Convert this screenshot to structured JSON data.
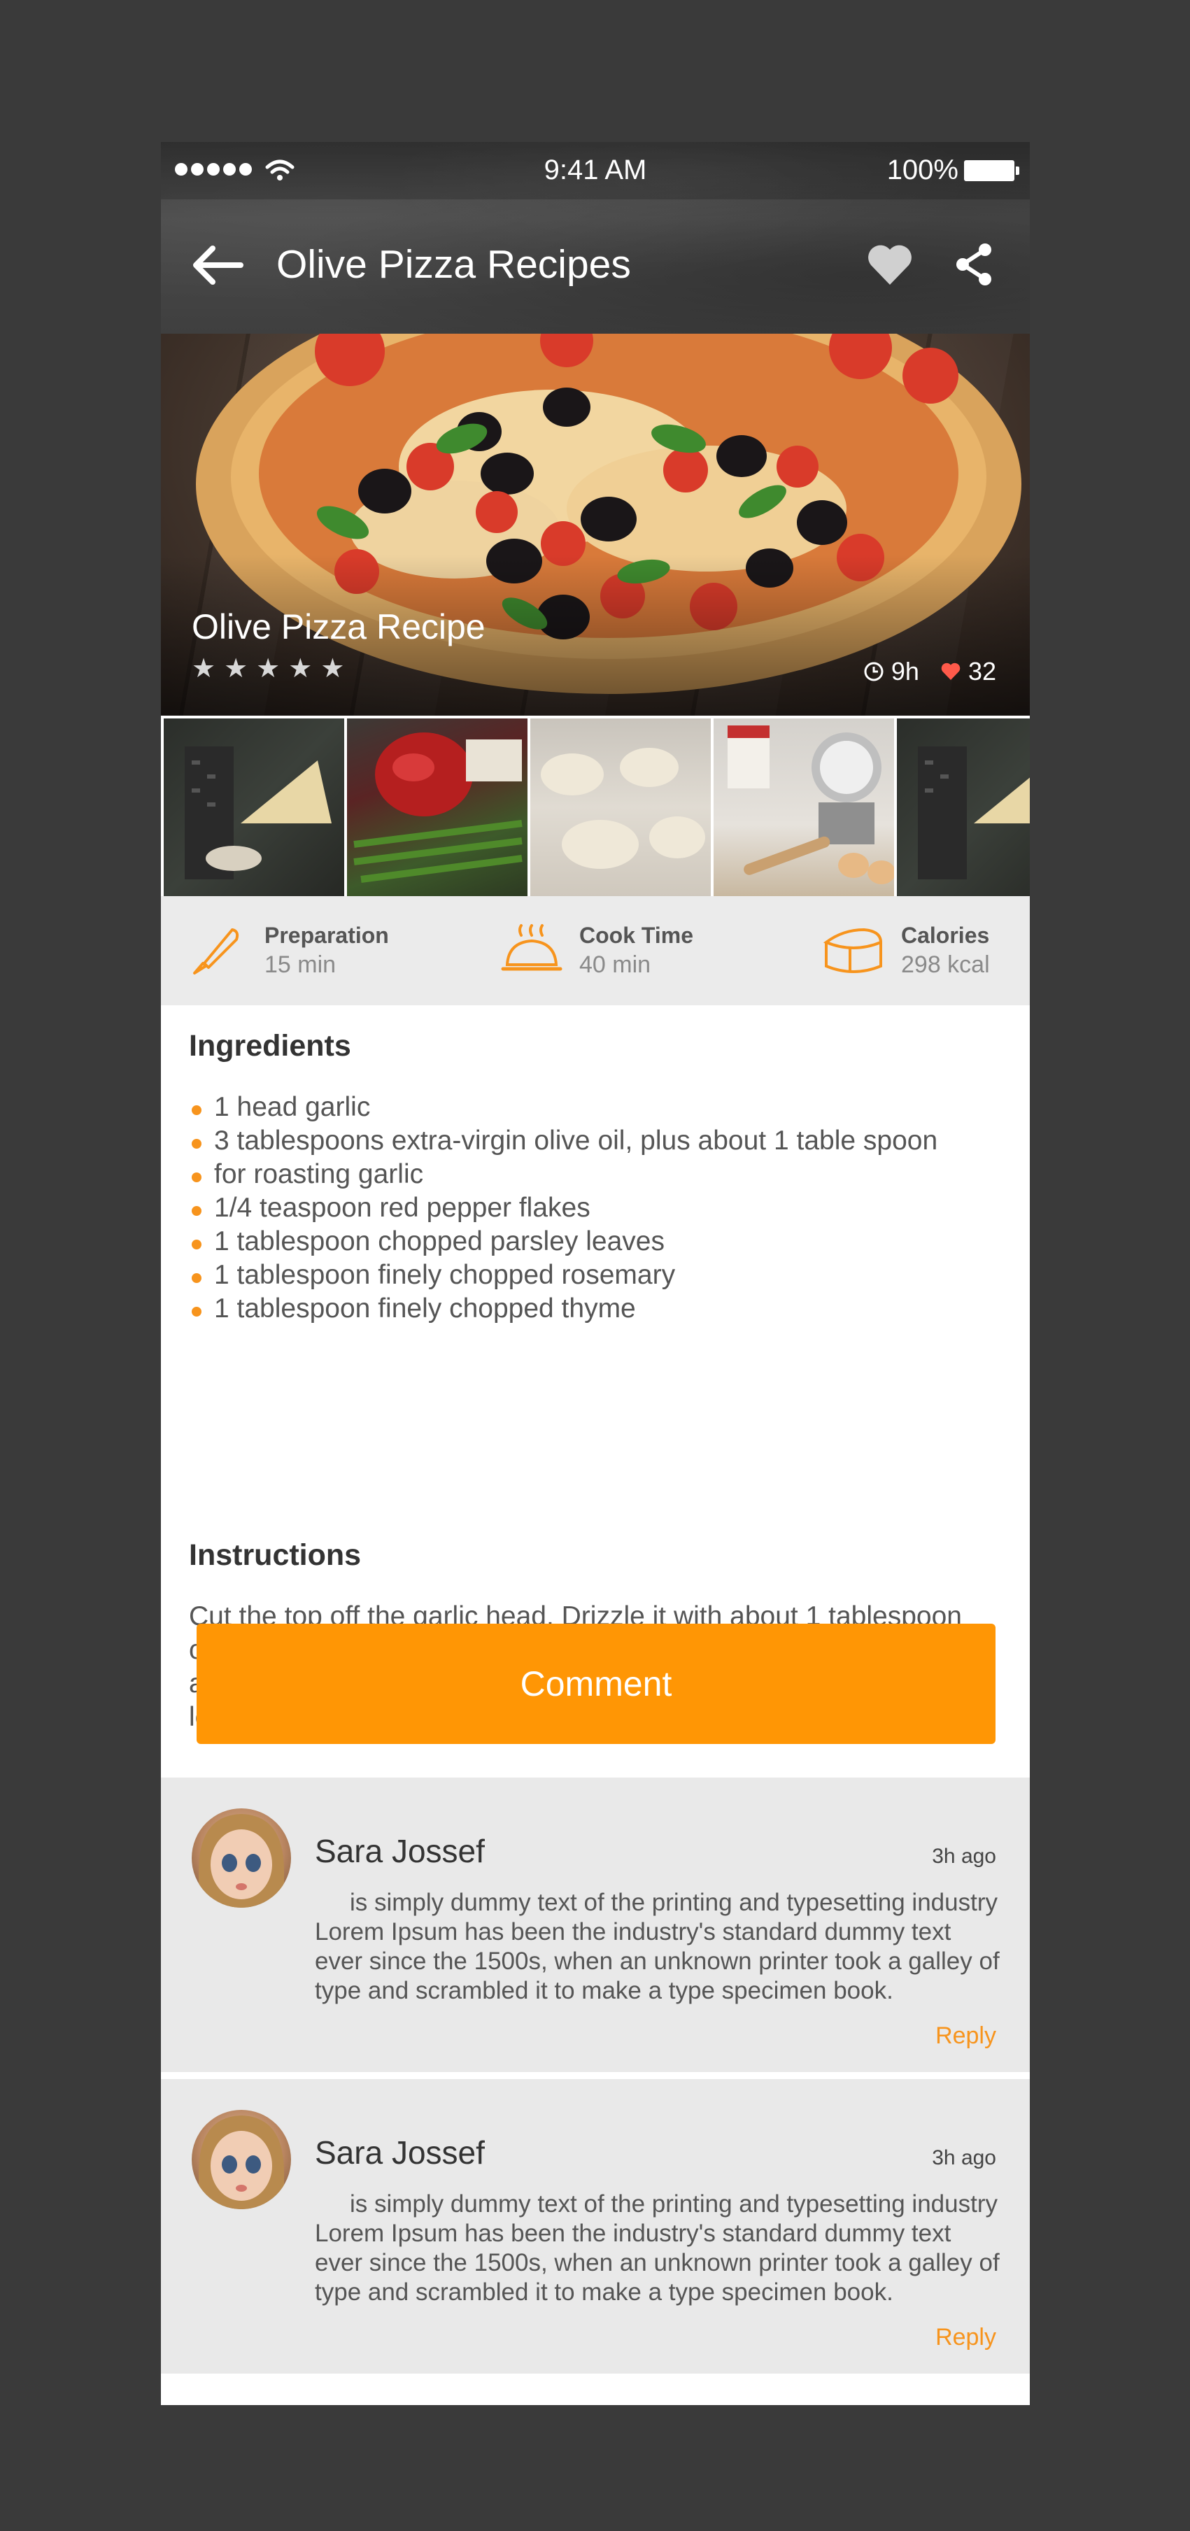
{
  "status_bar": {
    "time": "9:41 AM",
    "battery": "100%"
  },
  "nav": {
    "title": "Olive Pizza Recipes",
    "back_icon": "arrow-left-icon",
    "favorite_icon": "heart-icon",
    "share_icon": "share-icon"
  },
  "hero": {
    "title": "Olive Pizza Recipe",
    "rating_stars": 5,
    "time": "9h",
    "likes": "32"
  },
  "thumbnails": [
    {
      "subject": "grater-and-cheese"
    },
    {
      "subject": "vegetables"
    },
    {
      "subject": "dough-balls"
    },
    {
      "subject": "kitchen-scale"
    },
    {
      "subject": "grater-and-cheese"
    }
  ],
  "stats": [
    {
      "label": "Preparation",
      "value": "15 min",
      "icon": "knife-icon"
    },
    {
      "label": "Cook Time",
      "value": "40 min",
      "icon": "serving-dish-icon"
    },
    {
      "label": "Calories",
      "value": "298 kcal",
      "icon": "cheese-icon"
    }
  ],
  "ingredients": {
    "heading": "Ingredients",
    "items": [
      "1 head garlic",
      "3 tablespoons extra-virgin olive oil, plus about 1 table spoon",
      "for roasting garlic",
      "1/4 teaspoon red pepper flakes",
      "1 tablespoon chopped parsley leaves",
      "1 tablespoon finely chopped rosemary",
      "1 tablespoon finely chopped thyme"
    ]
  },
  "instructions": {
    "heading": "Instructions",
    "text": "Cut the top off the garlic head. Drizzle it with about 1 tablespoon olive oil, season with salt and pepper, to taste, and wrap in aluminum foil. Roast in the oven for 30 minutes, then remove and let cool."
  },
  "comment_button": "Comment",
  "comments": [
    {
      "name": "Sara Jossef",
      "ago": "3h ago",
      "text": "is simply dummy text of the printing and typesetting industry Lorem Ipsum has been the industry's standard dummy text ever since the 1500s, when an unknown printer took a galley of type and scrambled it to make a type specimen book.",
      "reply": "Reply"
    },
    {
      "name": "Sara Jossef",
      "ago": "3h ago",
      "text": "is simply dummy text of the printing and typesetting industry Lorem Ipsum has been the industry's standard dummy text ever since the 1500s, when an unknown printer took a galley of type and scrambled it to make a type specimen book.",
      "reply": "Reply"
    }
  ],
  "colors": {
    "accent": "#ff9605",
    "bullet": "#f7941d",
    "like_heart": "#ff5a4a",
    "page_bg": "#3a3a3a"
  }
}
